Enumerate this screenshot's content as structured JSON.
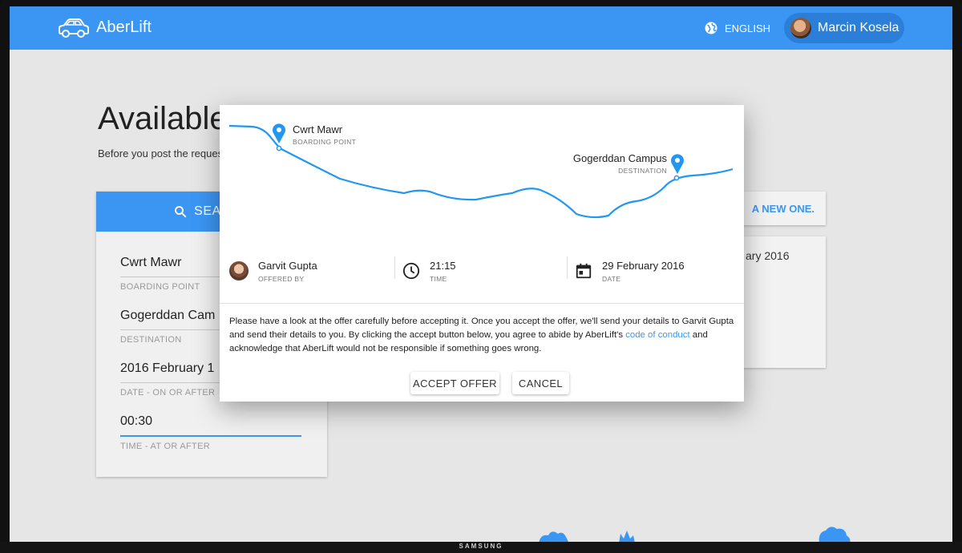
{
  "app": {
    "title": "AberLift",
    "language": "ENGLISH",
    "user_name": "Marcin Kosela"
  },
  "page": {
    "title": "Available",
    "subtitle": "Before you post the reques",
    "subtitle_right": ".",
    "post_new": "A NEW ONE.",
    "offer_card_date": "ary 2016"
  },
  "search": {
    "header": "SEARCH",
    "fields": [
      {
        "value": "Cwrt Mawr",
        "label": "BOARDING POINT"
      },
      {
        "value": "Gogerddan Cam",
        "label": "DESTINATION"
      },
      {
        "value": "2016 February 1",
        "label": "DATE - ON OR AFTER"
      },
      {
        "value": "00:30",
        "label": "TIME - AT OR AFTER"
      }
    ]
  },
  "dialog": {
    "boarding": {
      "name": "Cwrt Mawr",
      "label": "BOARDING POINT"
    },
    "destination": {
      "name": "Gogerddan Campus",
      "label": "DESTINATION"
    },
    "driver": {
      "name": "Garvit Gupta",
      "label": "OFFERED BY"
    },
    "time": {
      "value": "21:15",
      "label": "TIME"
    },
    "date": {
      "value": "29 February 2016",
      "label": "DATE"
    },
    "text_before_link": "Please have a look at the offer carefully before accepting it. Once you accept the offer, we'll send your details to Garvit Gupta and send their details to you. By clicking the accept button below, you agree to abide by AberLift's ",
    "link_text": "code of conduct",
    "text_after_link": " and acknowledge that AberLift would not be responsible if something goes wrong.",
    "accept_label": "ACCEPT OFFER",
    "cancel_label": "CANCEL"
  },
  "tv_brand": "SAMSUNG",
  "colors": {
    "primary": "#3b96f3",
    "primary_dark": "#2c7fd8",
    "route": "#2196f3"
  }
}
